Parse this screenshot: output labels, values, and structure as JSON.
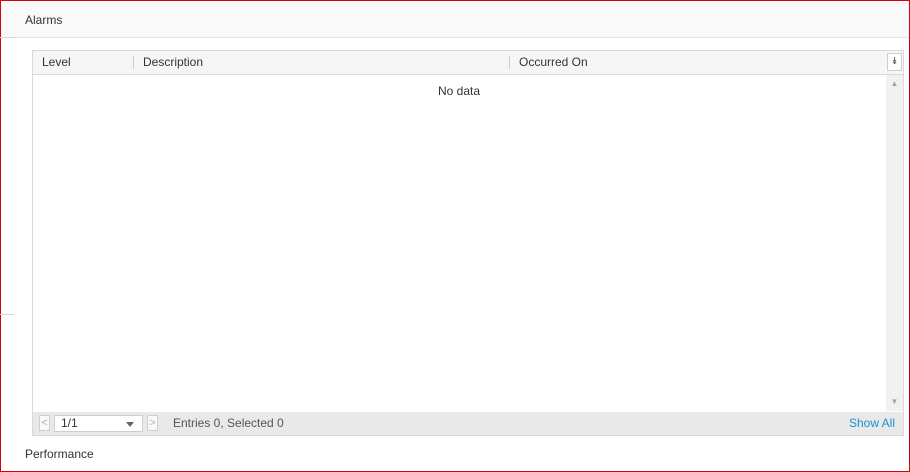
{
  "alarms": {
    "title": "Alarms",
    "columns": [
      "Level",
      "Description",
      "Occurred On"
    ],
    "empty_text": "No data",
    "pager": {
      "page_value": "1/1",
      "prev_glyph": "<",
      "next_glyph": ">",
      "entries_text": "Entries 0, Selected 0",
      "show_all_label": "Show All"
    }
  },
  "performance": {
    "title": "Performance"
  },
  "colors": {
    "frame_border": "#d6000f",
    "link": "#1a8fd8"
  }
}
